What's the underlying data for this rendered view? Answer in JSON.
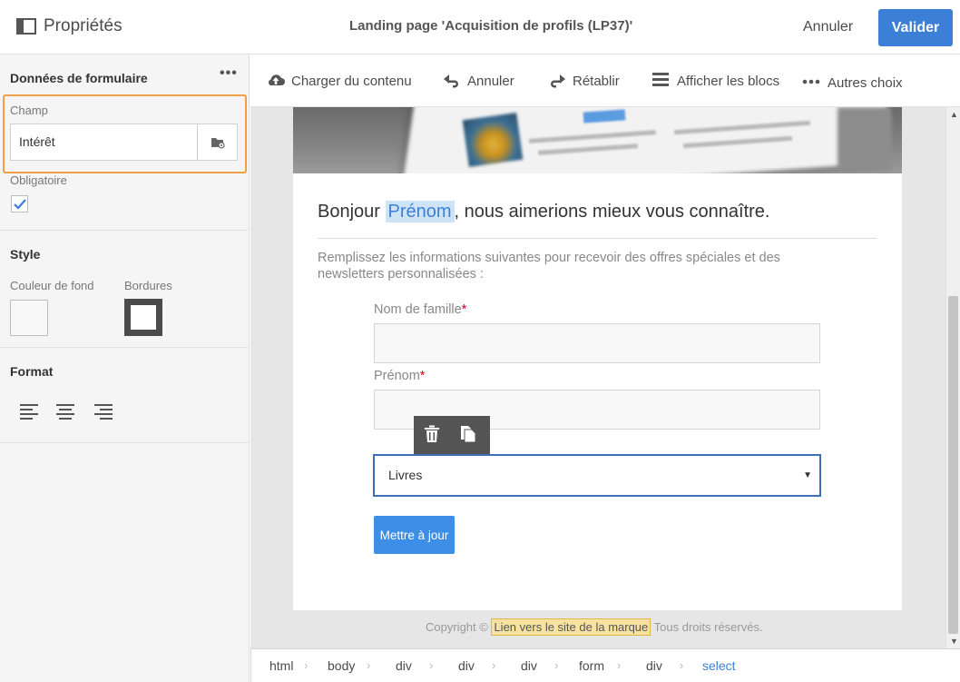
{
  "header": {
    "title": "Propriétés",
    "document_title": "Landing page 'Acquisition de profils (LP37)'",
    "cancel_label": "Annuler",
    "validate_label": "Valider"
  },
  "left_panel": {
    "section_form": "Données de formulaire",
    "more_label": "•••",
    "field_label": "Champ",
    "field_value": "Intérêt",
    "required_label": "Obligatoire",
    "required_checked": true,
    "section_style": "Style",
    "background_color_label": "Couleur de fond",
    "borders_label": "Bordures",
    "section_format": "Format",
    "align_options": [
      "align-left",
      "align-center",
      "align-right"
    ]
  },
  "toolbar": {
    "items": [
      {
        "label": "Charger du contenu",
        "icon": "cloud-upload-icon"
      },
      {
        "label": "Annuler",
        "icon": "undo-icon"
      },
      {
        "label": "Rétablir",
        "icon": "redo-icon"
      },
      {
        "label": "Afficher les blocs",
        "icon": "blocks-icon"
      },
      {
        "label": "Autres choix",
        "icon": "more-icon"
      }
    ]
  },
  "page": {
    "greeting_before": "Bonjour ",
    "greeting_token": "Prénom",
    "greeting_after": ", nous aimerions mieux vous connaître.",
    "intro": "Remplissez les informations suivantes pour recevoir des offres spéciales et des newsletters personnalisées :",
    "field_lastname": "Nom de famille",
    "field_firstname": "Prénom",
    "required_mark": "*",
    "select_value": "Livres",
    "update_button": "Mettre à jour",
    "footer_prefix": "Copyright © ",
    "footer_link": "Lien vers le site de la marque",
    "footer_suffix": " Tous droits réservés."
  },
  "breadcrumb": [
    "html",
    "body",
    "div",
    "div",
    "div",
    "form",
    "div",
    "select"
  ],
  "colors": {
    "accent": "#3c7fd6",
    "selection_outline": "#f0a046",
    "highlight": "#cfe3f7"
  }
}
